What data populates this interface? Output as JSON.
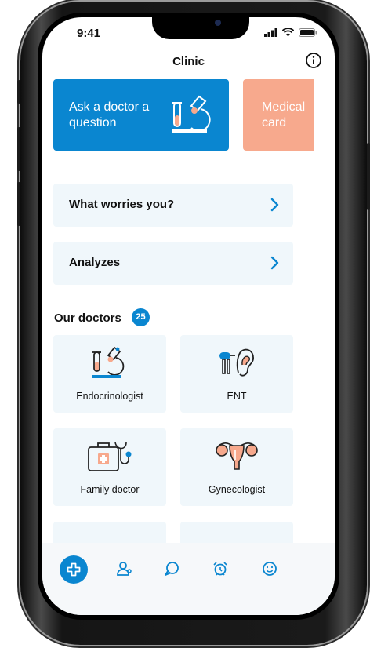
{
  "status": {
    "time": "9:41"
  },
  "header": {
    "title": "Clinic"
  },
  "cards": [
    {
      "label": "Ask a doctor a question",
      "color": "#0a86d0"
    },
    {
      "label": "Medical card",
      "color": "#f7a98d"
    }
  ],
  "rows": [
    {
      "label": "What worries you?"
    },
    {
      "label": "Analyzes"
    }
  ],
  "doctors": {
    "title": "Our doctors",
    "count": "25",
    "items": [
      {
        "label": "Endocrinologist",
        "icon": "microscope-icon"
      },
      {
        "label": "ENT",
        "icon": "ear-icon"
      },
      {
        "label": "Family doctor",
        "icon": "medical-bag-icon"
      },
      {
        "label": "Gynecologist",
        "icon": "uterus-icon"
      }
    ]
  },
  "tabbar": {
    "items": [
      {
        "icon": "plus-icon",
        "active": true
      },
      {
        "icon": "doctor-icon"
      },
      {
        "icon": "chat-icon"
      },
      {
        "icon": "alarm-icon"
      },
      {
        "icon": "smile-icon"
      }
    ]
  },
  "colors": {
    "accent": "#0a86d0",
    "peach": "#f7a98d",
    "tile_bg": "#f0f7fb"
  }
}
